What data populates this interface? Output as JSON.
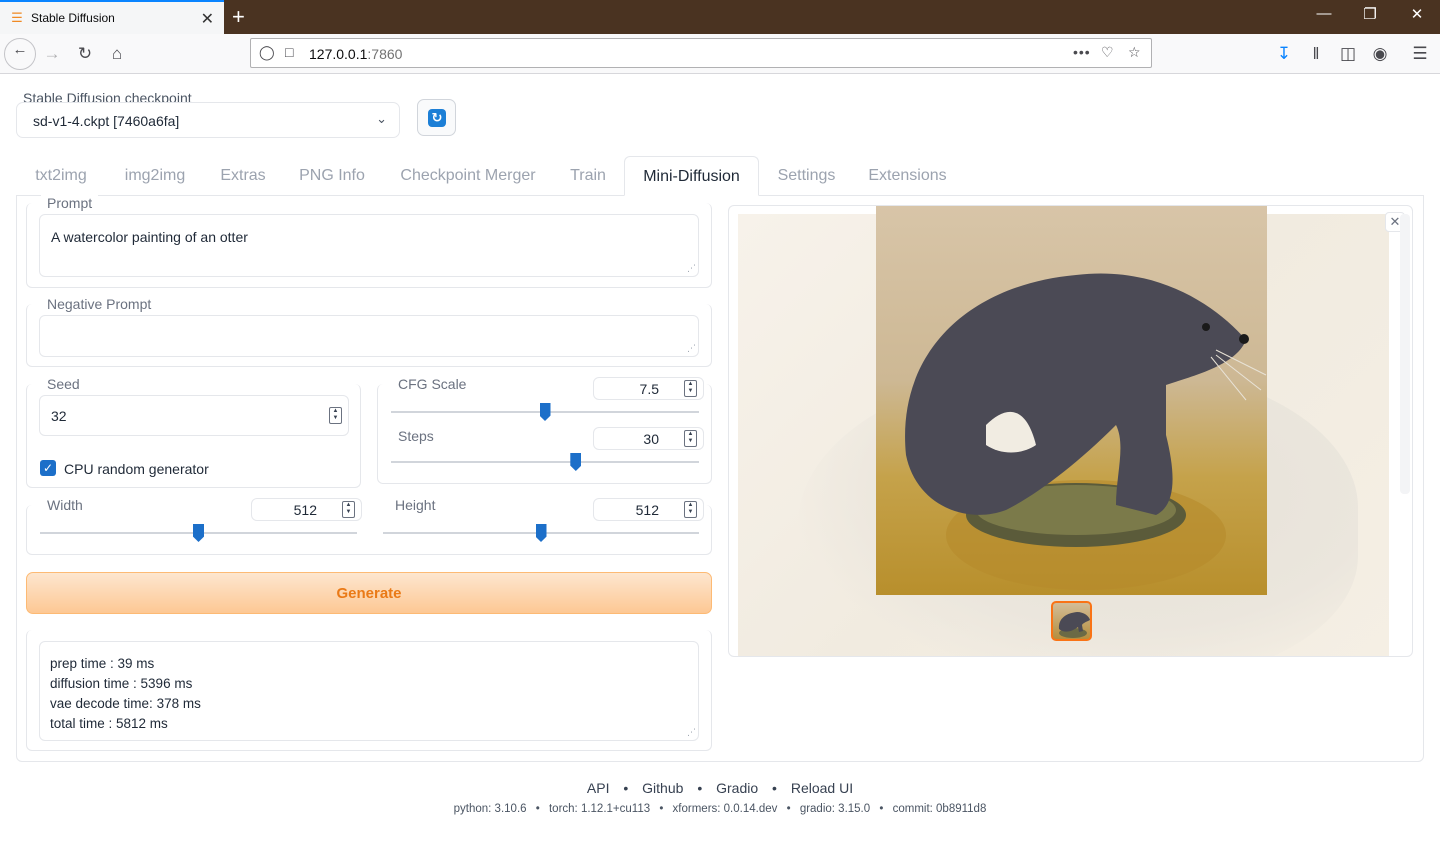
{
  "browser": {
    "tab_title": "Stable Diffusion",
    "url_host": "127.0.0.1",
    "url_port": ":7860"
  },
  "checkpoint": {
    "label": "Stable Diffusion checkpoint",
    "value": "sd-v1-4.ckpt [7460a6fa]"
  },
  "tabs": [
    "txt2img",
    "img2img",
    "Extras",
    "PNG Info",
    "Checkpoint Merger",
    "Train",
    "Mini-Diffusion",
    "Settings",
    "Extensions"
  ],
  "active_tab": "Mini-Diffusion",
  "prompt": {
    "label": "Prompt",
    "value": "A watercolor painting of an otter"
  },
  "negative_prompt": {
    "label": "Negative Prompt",
    "value": ""
  },
  "seed": {
    "label": "Seed",
    "value": "32"
  },
  "cpu_random": {
    "label": "CPU random generator",
    "checked": true
  },
  "cfg_scale": {
    "label": "CFG Scale",
    "value": "7.5",
    "fraction": 0.5
  },
  "steps": {
    "label": "Steps",
    "value": "30",
    "fraction": 0.6
  },
  "width": {
    "label": "Width",
    "value": "512",
    "fraction": 0.5
  },
  "height": {
    "label": "Height",
    "value": "512",
    "fraction": 0.5
  },
  "generate_label": "Generate",
  "output": {
    "lines": [
      "prep time : 39 ms",
      "diffusion time : 5396 ms",
      "vae decode time: 378 ms",
      "total time : 5812 ms"
    ]
  },
  "footer": {
    "links": [
      "API",
      "Github",
      "Gradio",
      "Reload UI"
    ],
    "info": [
      "python: 3.10.6",
      "torch: 1.12.1+cu113",
      "xformers: 0.0.14.dev",
      "gradio: 3.15.0",
      "commit: 0b8911d8"
    ]
  },
  "colors": {
    "accent": "#1c6fc9",
    "generate": "#ea7a17",
    "titlebar": "#4a3321"
  }
}
